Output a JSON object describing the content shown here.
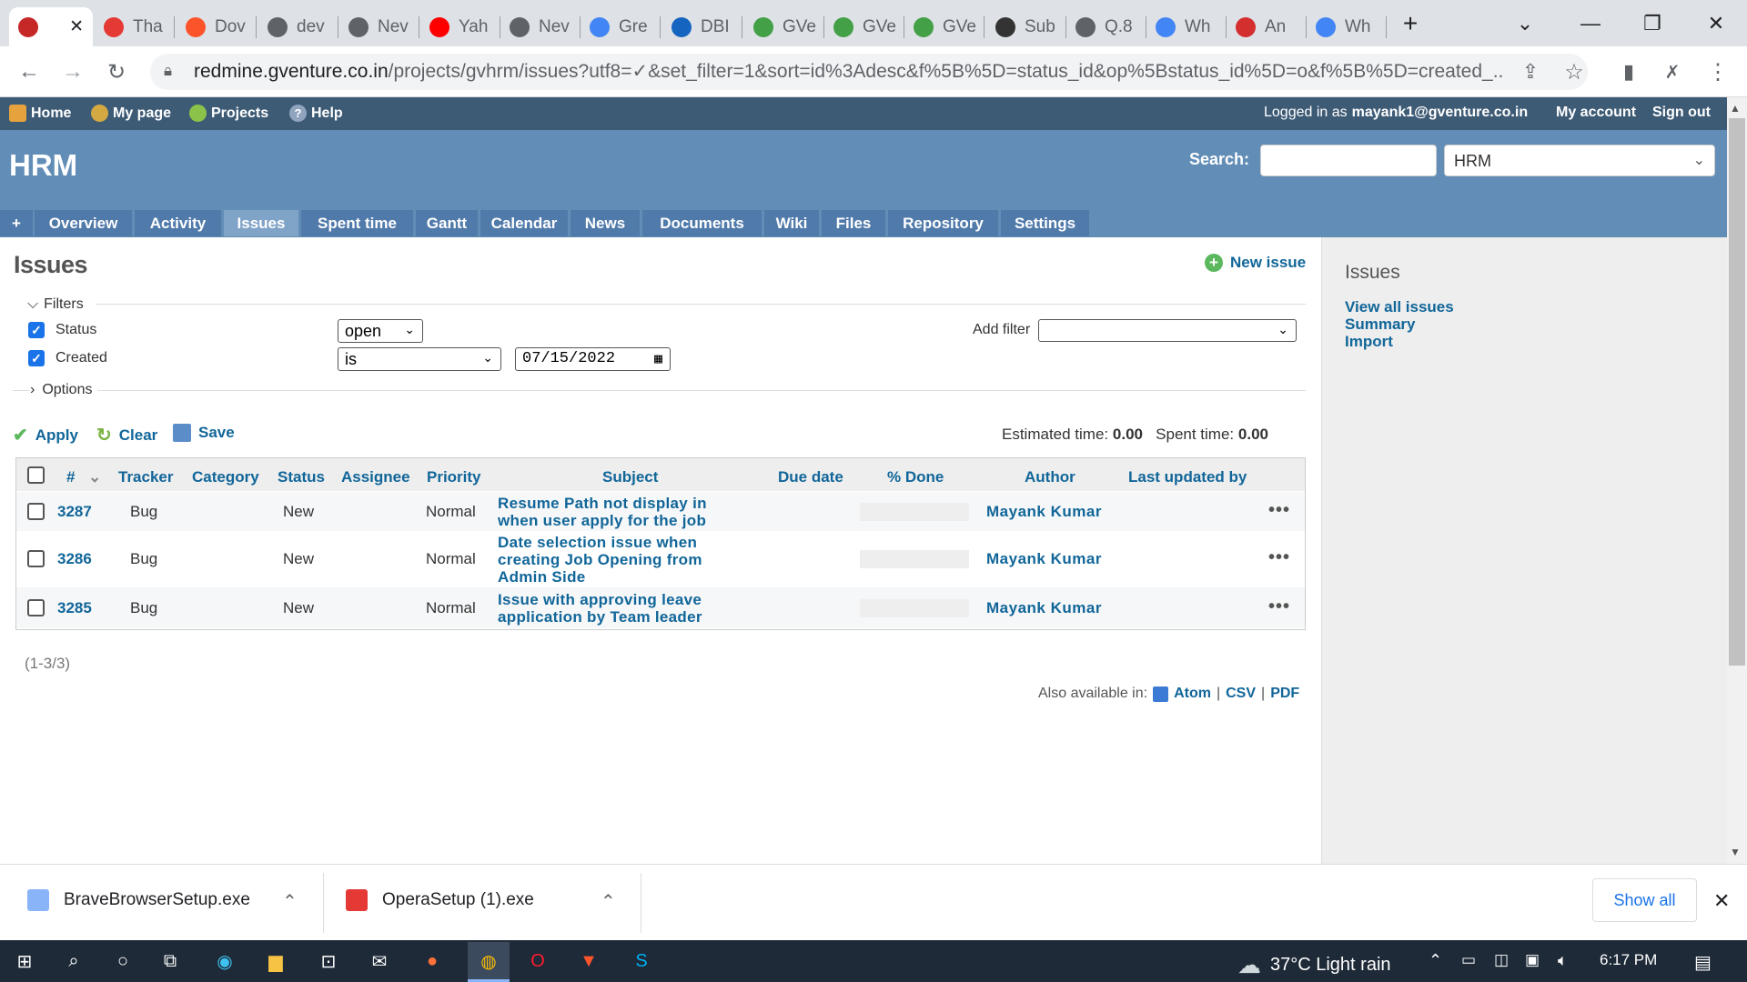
{
  "browser": {
    "tabs": [
      {
        "title": "",
        "icon": "redmine-icon",
        "color": "#c62828",
        "active": true
      },
      {
        "title": "Tha",
        "icon": "opera-icon",
        "color": "#e53935"
      },
      {
        "title": "Dov",
        "icon": "brave-icon",
        "color": "#fb542b"
      },
      {
        "title": "dev",
        "icon": "globe-icon",
        "color": "#5f6368"
      },
      {
        "title": "Nev",
        "icon": "chrome-icon",
        "color": "#5f6368"
      },
      {
        "title": "Yah",
        "icon": "youtube-icon",
        "color": "#ff0000"
      },
      {
        "title": "Nev",
        "icon": "chrome-icon",
        "color": "#5f6368"
      },
      {
        "title": "Gre",
        "icon": "google-icon",
        "color": "#4285f4"
      },
      {
        "title": "DBI",
        "icon": "database-icon",
        "color": "#1565c0"
      },
      {
        "title": "GVe",
        "icon": "gventure-icon",
        "color": "#43a047"
      },
      {
        "title": "GVe",
        "icon": "gventure-icon",
        "color": "#43a047"
      },
      {
        "title": "GVe",
        "icon": "gventure-icon",
        "color": "#43a047"
      },
      {
        "title": "Sub",
        "icon": "diamond-icon",
        "color": "#333333"
      },
      {
        "title": "Q.8",
        "icon": "edit-icon",
        "color": "#5f6368"
      },
      {
        "title": "Wh",
        "icon": "google-icon",
        "color": "#4285f4"
      },
      {
        "title": "An",
        "icon": "vivaldi-icon",
        "color": "#d32f2f"
      },
      {
        "title": "Wh",
        "icon": "google-icon",
        "color": "#4285f4"
      }
    ],
    "url_host": "redmine.gventure.co.in",
    "url_rest": "/projects/gvhrm/issues?utf8=✓&set_filter=1&sort=id%3Adesc&f%5B%5D=status_id&op%5Bstatus_id%5D=o&f%5B%5D=created_..."
  },
  "topmenu": {
    "home": "Home",
    "mypage": "My page",
    "projects": "Projects",
    "help": "Help",
    "logged_prefix": "Logged in as",
    "user": "mayank1@gventure.co.in",
    "myaccount": "My account",
    "signout": "Sign out"
  },
  "header": {
    "title": "HRM",
    "search_label": "Search:",
    "project_select": "HRM"
  },
  "mainmenu": [
    "+",
    "Overview",
    "Activity",
    "Issues",
    "Spent time",
    "Gantt",
    "Calendar",
    "News",
    "Documents",
    "Wiki",
    "Files",
    "Repository",
    "Settings"
  ],
  "content": {
    "heading": "Issues",
    "new_issue": "New issue",
    "filters_label": "Filters",
    "filter_status": "Status",
    "filter_status_value": "open",
    "filter_created": "Created",
    "filter_created_op": "is",
    "filter_created_date": "07/15/2022",
    "add_filter": "Add filter",
    "options_label": "Options",
    "apply": "Apply",
    "clear": "Clear",
    "save": "Save",
    "estimated_label": "Estimated time:",
    "estimated_value": "0.00",
    "spent_label": "Spent time:",
    "spent_value": "0.00",
    "columns": [
      "#",
      "Tracker",
      "Category",
      "Status",
      "Assignee",
      "Priority",
      "Subject",
      "Due date",
      "% Done",
      "Author",
      "Last updated by"
    ],
    "rows": [
      {
        "id": "3287",
        "tracker": "Bug",
        "status": "New",
        "priority": "Normal",
        "subject_lines": [
          "Resume Path not display in",
          "when user apply for the job"
        ],
        "author": "Mayank Kumar"
      },
      {
        "id": "3286",
        "tracker": "Bug",
        "status": "New",
        "priority": "Normal",
        "subject_lines": [
          "Date selection issue when",
          "creating Job Opening from",
          "Admin Side"
        ],
        "author": "Mayank Kumar"
      },
      {
        "id": "3285",
        "tracker": "Bug",
        "status": "New",
        "priority": "Normal",
        "subject_lines": [
          "Issue with approving leave",
          "application by Team leader"
        ],
        "author": "Mayank Kumar"
      }
    ],
    "pagination": "(1-3/3)",
    "also_available": "Also available in:",
    "formats": [
      "Atom",
      "CSV",
      "PDF"
    ]
  },
  "sidebar": {
    "heading": "Issues",
    "links": [
      "View all issues",
      "Summary",
      "Import"
    ]
  },
  "downloads": {
    "items": [
      "BraveBrowserSetup.exe",
      "OperaSetup (1).exe"
    ],
    "show_all": "Show all"
  },
  "taskbar": {
    "weather": "37°C  Light rain",
    "time": "6:17 PM"
  }
}
